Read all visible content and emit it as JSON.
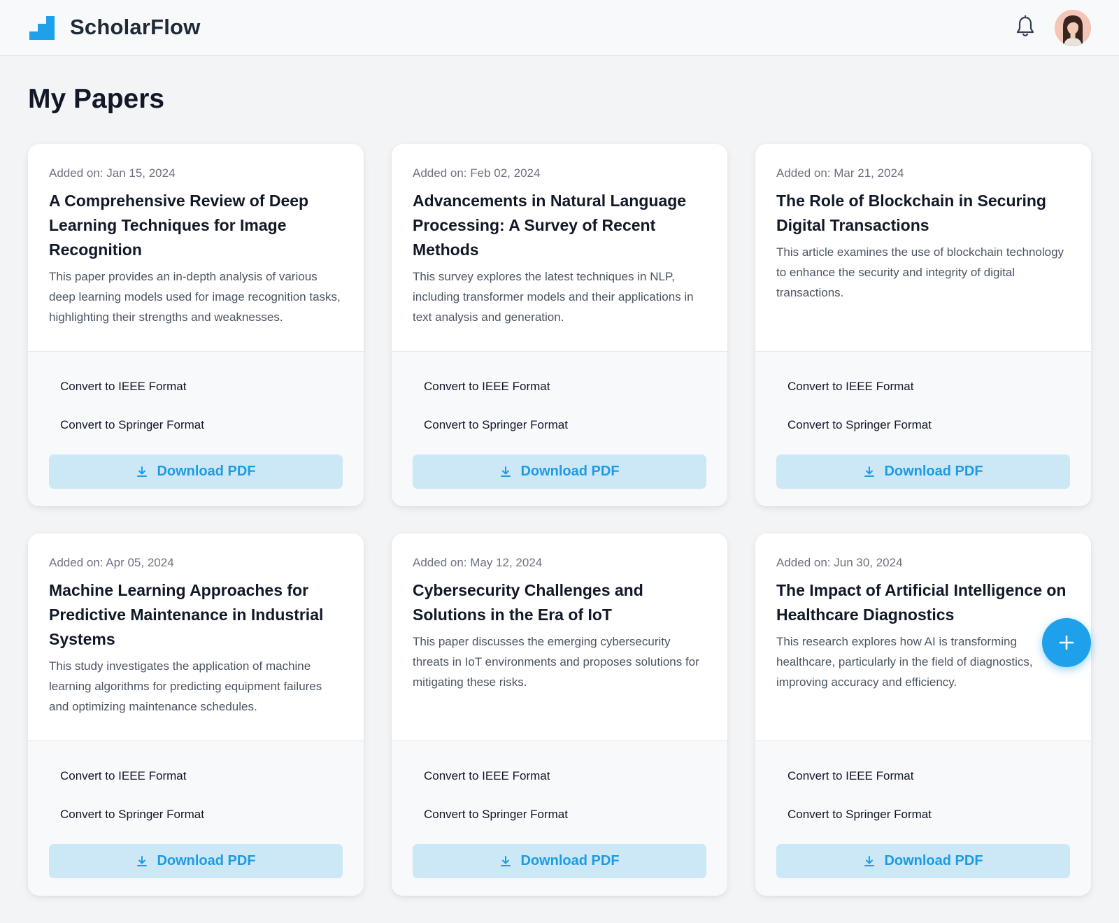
{
  "app": {
    "brand": "ScholarFlow",
    "logo_icon": "stairs-logo-icon",
    "notification_icon": "bell-icon",
    "avatar_icon": "user-avatar",
    "accent_color": "#1ea1ea"
  },
  "page": {
    "title": "My Papers"
  },
  "papers": [
    {
      "date": "Added on: Jan 15, 2024",
      "title": "A Comprehensive Review of Deep Learning Techniques for Image Recognition",
      "description": "This paper provides an in-depth analysis of various deep learning models used for image recognition tasks, highlighting their strengths and weaknesses.",
      "option_ieee": "Convert to IEEE Format",
      "option_springer": "Convert to Springer Format",
      "download_label": "Download PDF"
    },
    {
      "date": "Added on: Feb 02, 2024",
      "title": "Advancements in Natural Language Processing: A Survey of Recent Methods",
      "description": "This survey explores the latest techniques in NLP, including transformer models and their applications in text analysis and generation.",
      "option_ieee": "Convert to IEEE Format",
      "option_springer": "Convert to Springer Format",
      "download_label": "Download PDF"
    },
    {
      "date": "Added on: Mar 21, 2024",
      "title": "The Role of Blockchain in Securing Digital Transactions",
      "description": "This article examines the use of blockchain technology to enhance the security and integrity of digital transactions.",
      "option_ieee": "Convert to IEEE Format",
      "option_springer": "Convert to Springer Format",
      "download_label": "Download PDF"
    },
    {
      "date": "Added on: Apr 05, 2024",
      "title": "Machine Learning Approaches for Predictive Maintenance in Industrial Systems",
      "description": "This study investigates the application of machine learning algorithms for predicting equipment failures and optimizing maintenance schedules.",
      "option_ieee": "Convert to IEEE Format",
      "option_springer": "Convert to Springer Format",
      "download_label": "Download PDF"
    },
    {
      "date": "Added on: May 12, 2024",
      "title": "Cybersecurity Challenges and Solutions in the Era of IoT",
      "description": "This paper discusses the emerging cybersecurity threats in IoT environments and proposes solutions for mitigating these risks.",
      "option_ieee": "Convert to IEEE Format",
      "option_springer": "Convert to Springer Format",
      "download_label": "Download PDF"
    },
    {
      "date": "Added on: Jun 30, 2024",
      "title": "The Impact of Artificial Intelligence on Healthcare Diagnostics",
      "description": "This research explores how AI is transforming healthcare, particularly in the field of diagnostics, improving accuracy and efficiency.",
      "option_ieee": "Convert to IEEE Format",
      "option_springer": "Convert to Springer Format",
      "download_label": "Download PDF"
    }
  ],
  "fab": {
    "icon": "plus-icon"
  }
}
